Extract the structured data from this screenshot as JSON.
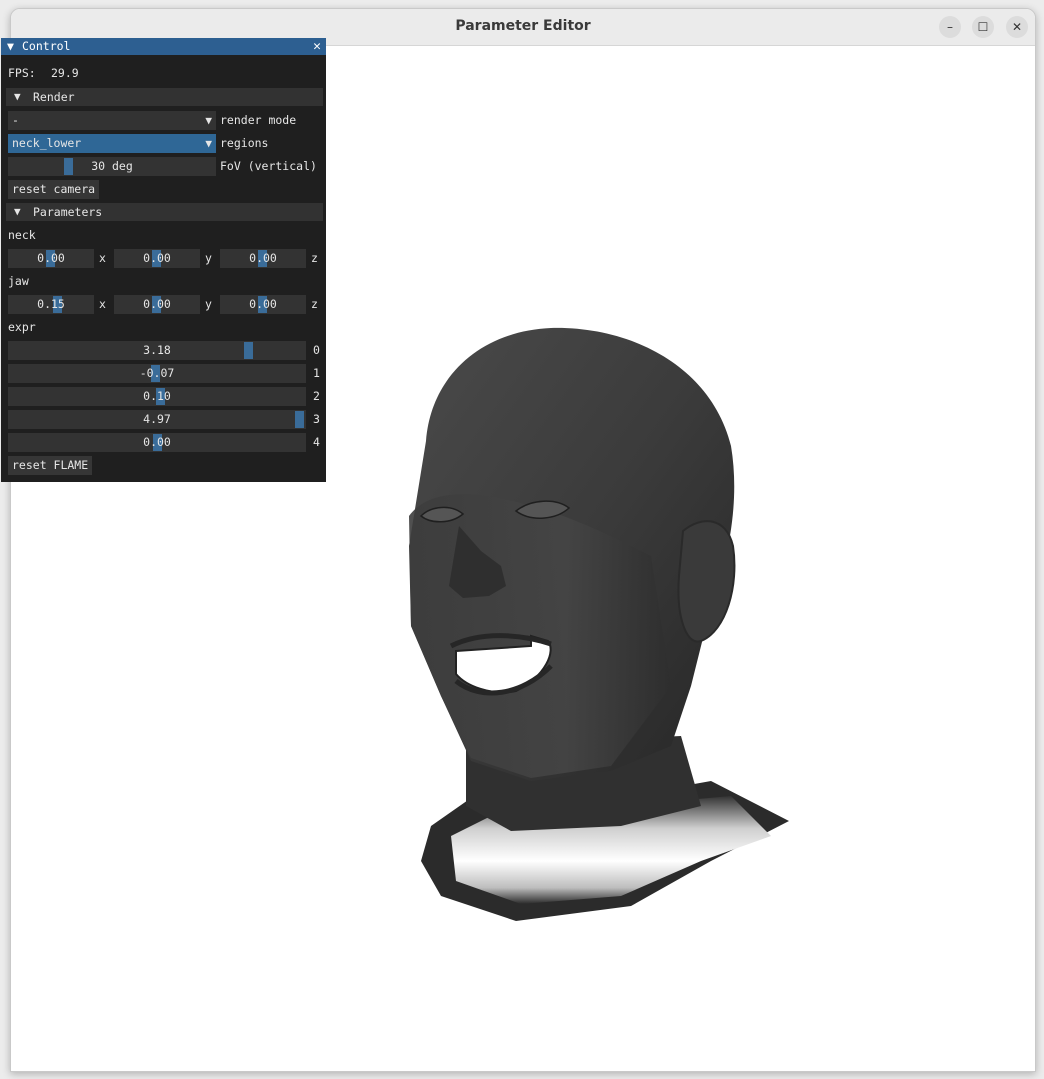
{
  "window": {
    "title": "Parameter Editor",
    "minimize": "–",
    "maximize": "☐",
    "close": "✕"
  },
  "panel": {
    "title": "Control",
    "collapse_glyph": "▼",
    "close_glyph": "✕",
    "fps_label": "FPS:",
    "fps_value": "29.9",
    "render": {
      "header": "Render",
      "render_mode_value": "-",
      "render_mode_label": "render mode",
      "regions_value": "neck_lower",
      "regions_label": "regions",
      "fov_value": "30 deg",
      "fov_label": "FoV (vertical)",
      "reset_camera": "reset camera"
    },
    "parameters": {
      "header": "Parameters",
      "neck_label": "neck",
      "neck": [
        {
          "value": "0.00",
          "axis": "x"
        },
        {
          "value": "0.00",
          "axis": "y"
        },
        {
          "value": "0.00",
          "axis": "z"
        }
      ],
      "jaw_label": "jaw",
      "jaw": [
        {
          "value": "0.15",
          "axis": "x"
        },
        {
          "value": "0.00",
          "axis": "y"
        },
        {
          "value": "0.00",
          "axis": "z"
        }
      ],
      "expr_label": "expr",
      "expr": [
        {
          "value": "3.18",
          "index": "0"
        },
        {
          "value": "-0.07",
          "index": "1"
        },
        {
          "value": "0.10",
          "index": "2"
        },
        {
          "value": "4.97",
          "index": "3"
        },
        {
          "value": "0.00",
          "index": "4"
        }
      ],
      "reset_flame": "reset FLAME"
    },
    "dropdown_arrow": "▼",
    "accent_color": "#2d5f91"
  }
}
